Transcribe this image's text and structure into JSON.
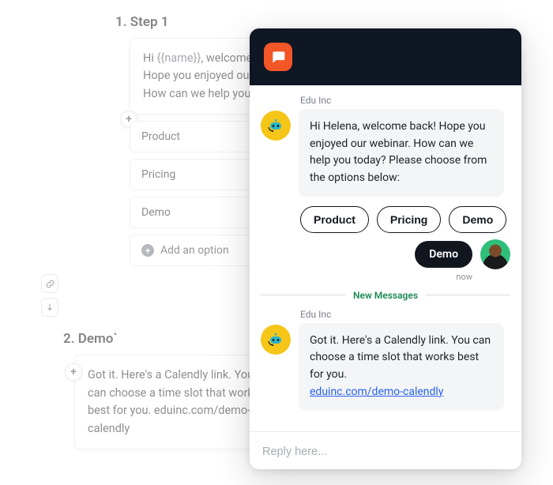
{
  "builder": {
    "step1": {
      "title": "1. Step 1",
      "message_lines": [
        "Hi ",
        "{{name}}",
        ", welcome b",
        "Hope you enjoyed our w",
        "How can we help you..."
      ],
      "options": [
        "Product",
        "Pricing",
        "Demo"
      ],
      "add_option": "Add an option"
    },
    "step2": {
      "title": "2. Demo`",
      "message": "Got it. Here's a Calendly link. You can choose a time slot that works best for you. eduinc.com/demo-calendly"
    }
  },
  "chat": {
    "bot_name": "Edu Inc",
    "msg1": "Hi Helena, welcome back! Hope you enjoyed our webinar. How can we help you today? Please choose from the options below:",
    "choices": [
      "Product",
      "Pricing",
      "Demo"
    ],
    "user_reply": "Demo",
    "timestamp": "now",
    "new_messages": "New Messages",
    "msg2_text": "Got it. Here's a Calendly link. You can choose a time slot that works best for you.",
    "msg2_link": "eduinc.com/demo-calendly",
    "reply_placeholder": "Reply here..."
  }
}
